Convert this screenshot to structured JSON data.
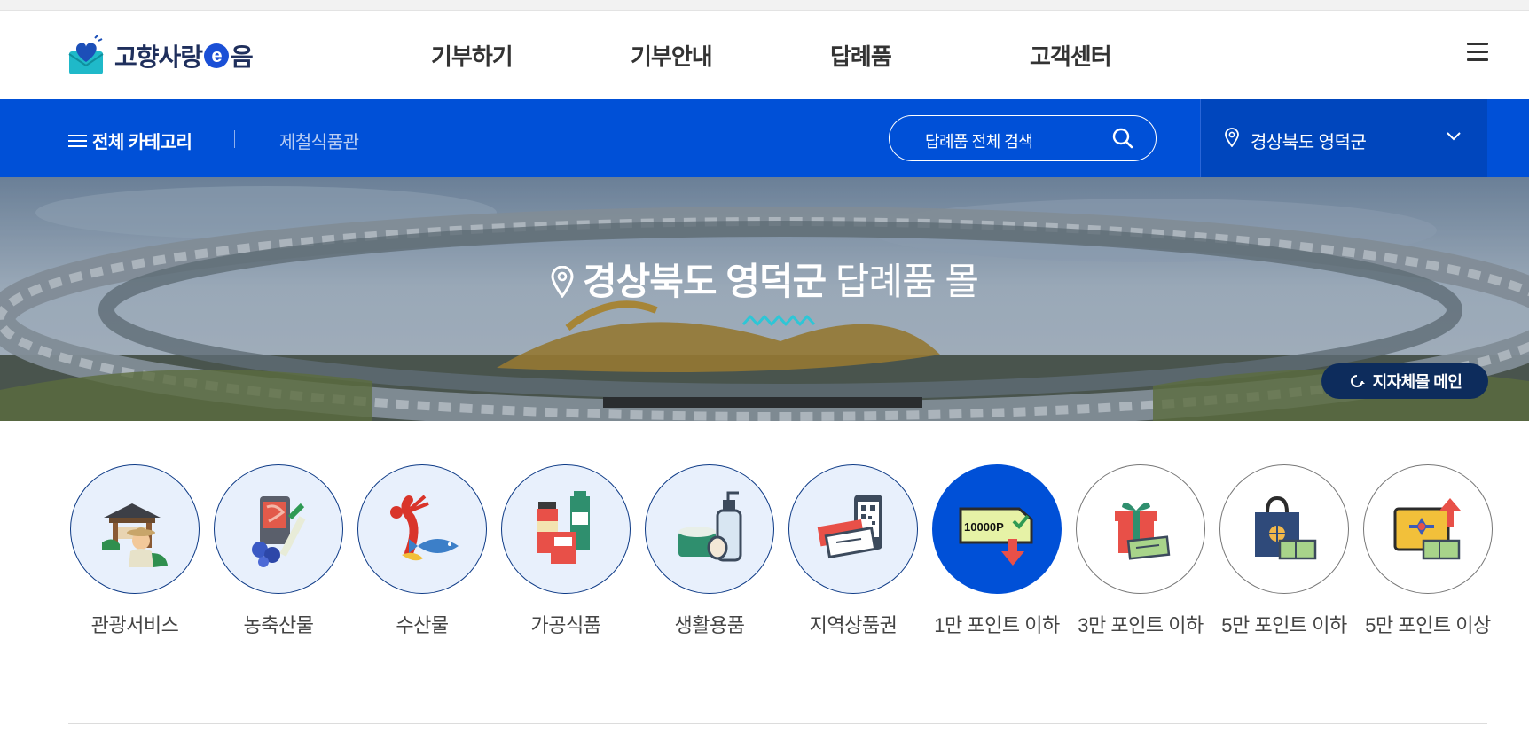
{
  "header": {
    "logo_text": "고향사랑",
    "logo_e": "e",
    "logo_suffix": "음",
    "nav": [
      "기부하기",
      "기부안내",
      "답례품",
      "고객센터"
    ],
    "menu_icon": "hamburger-icon"
  },
  "bluebar": {
    "all_category": "전체 카테고리",
    "sub_category": "제철식품관",
    "search_placeholder": "답례품 전체 검색",
    "search_icon": "search-icon",
    "region": "경상북도 영덕군",
    "region_icon": "location-pin-icon",
    "dropdown_icon": "chevron-down-icon"
  },
  "hero": {
    "title_bold": "경상북도 영덕군",
    "title_rest": "답례품 몰",
    "accent_color": "#2ec6d6",
    "mall_main_button": "지자체몰 메인"
  },
  "categories": [
    {
      "label": "관광서비스",
      "icon": "tourist-guide-icon",
      "style": "light"
    },
    {
      "label": "농축산물",
      "icon": "meat-vegetable-icon",
      "style": "light"
    },
    {
      "label": "수산물",
      "icon": "lobster-fish-icon",
      "style": "light"
    },
    {
      "label": "가공식품",
      "icon": "processed-food-icon",
      "style": "light"
    },
    {
      "label": "생활용품",
      "icon": "cosmetics-icon",
      "style": "light"
    },
    {
      "label": "지역상품권",
      "icon": "voucher-qr-icon",
      "style": "light"
    },
    {
      "label": "1만 포인트 이하",
      "icon": "point-coupon-icon",
      "style": "active",
      "coupon_text": "10000P"
    },
    {
      "label": "3만 포인트 이하",
      "icon": "gift-box-icon",
      "style": "white"
    },
    {
      "label": "5만 포인트 이하",
      "icon": "shopping-bag-icon",
      "style": "white"
    },
    {
      "label": "5만 포인트 이상",
      "icon": "gift-card-icon",
      "style": "white"
    }
  ],
  "colors": {
    "primary": "#0050d7",
    "region_bg": "#0046bd",
    "navy": "#0d2c5c",
    "category_bg": "#e8f0fc"
  }
}
